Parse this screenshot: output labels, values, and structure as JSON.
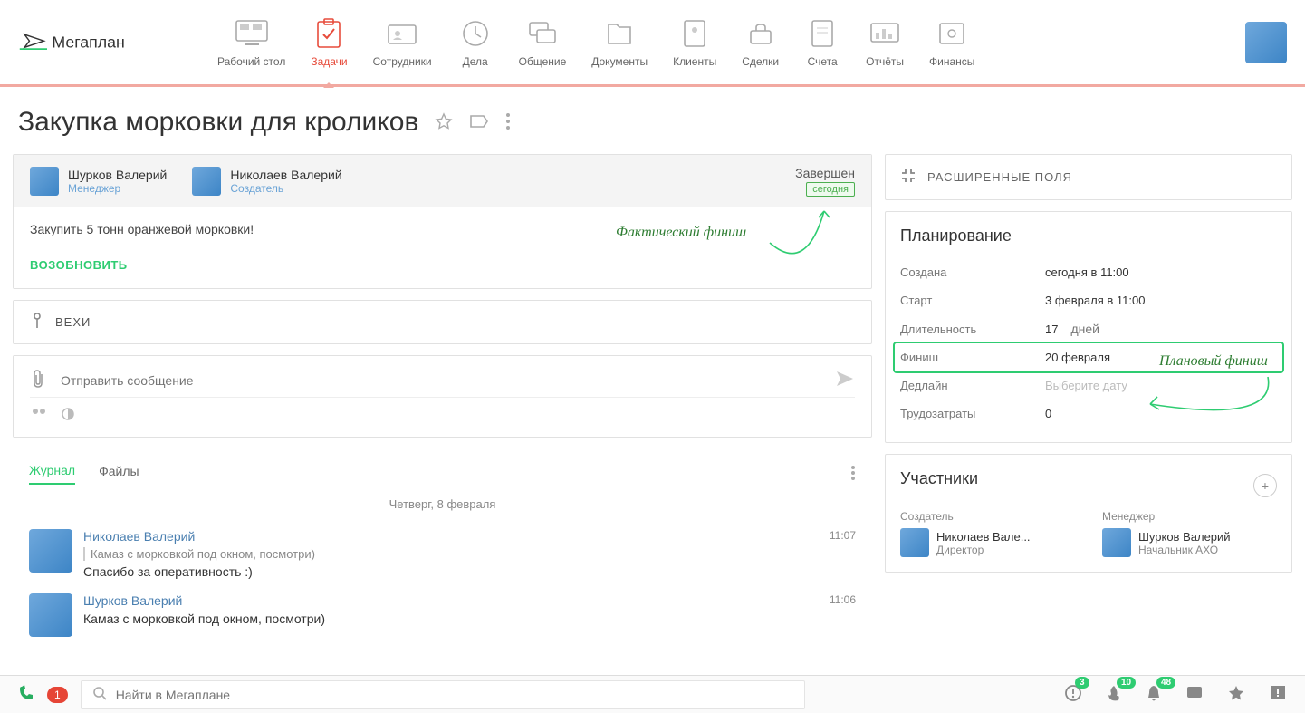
{
  "logo": "Мегаплан",
  "nav": [
    {
      "label": "Рабочий стол"
    },
    {
      "label": "Задачи"
    },
    {
      "label": "Сотрудники"
    },
    {
      "label": "Дела"
    },
    {
      "label": "Общение"
    },
    {
      "label": "Документы"
    },
    {
      "label": "Клиенты"
    },
    {
      "label": "Сделки"
    },
    {
      "label": "Счета"
    },
    {
      "label": "Отчёты"
    },
    {
      "label": "Финансы"
    }
  ],
  "page_title": "Закупка морковки для кроликов",
  "task_header": {
    "manager": {
      "name": "Шурков Валерий",
      "role": "Менеджер"
    },
    "creator": {
      "name": "Николаев Валерий",
      "role": "Создатель"
    },
    "status": "Завершен",
    "status_badge": "сегодня"
  },
  "task_body": {
    "description": "Закупить 5 тонн оранжевой морковки!",
    "resume": "ВОЗОБНОВИТЬ"
  },
  "milestones_label": "ВЕХИ",
  "message": {
    "placeholder": "Отправить сообщение"
  },
  "tabs": {
    "journal": "Журнал",
    "files": "Файлы"
  },
  "journal": {
    "date": "Четверг, 8 февраля",
    "entries": [
      {
        "author": "Николаев Валерий",
        "quote": "Камаз с морковкой под окном, посмотри)",
        "text": "Спасибо за оперативность :)",
        "time": "11:07"
      },
      {
        "author": "Шурков Валерий",
        "text": "Камаз с морковкой под окном, посмотри)",
        "time": "11:06"
      }
    ]
  },
  "sidebar": {
    "expand_fields": "РАСШИРЕННЫЕ ПОЛЯ",
    "planning": {
      "title": "Планирование",
      "rows": {
        "created": {
          "label": "Создана",
          "value": "сегодня в 11:00"
        },
        "start": {
          "label": "Старт",
          "value": "3 февраля в 11:00"
        },
        "duration": {
          "label": "Длительность",
          "value": "17",
          "unit": "дней"
        },
        "finish": {
          "label": "Финиш",
          "value": "20 февраля"
        },
        "deadline": {
          "label": "Дедлайн",
          "placeholder": "Выберите дату"
        },
        "labor": {
          "label": "Трудозатраты",
          "value": "0"
        }
      }
    },
    "participants": {
      "title": "Участники",
      "creator_label": "Создатель",
      "manager_label": "Менеджер",
      "creator": {
        "name": "Николаев Вале...",
        "title": "Директор"
      },
      "manager": {
        "name": "Шурков Валерий",
        "title": "Начальник АХО"
      }
    }
  },
  "annotations": {
    "actual_finish": "Фактический финиш",
    "planned_finish": "Плановый финиш"
  },
  "bottom": {
    "phone_badge": "1",
    "search_placeholder": "Найти в Мегаплане",
    "counts": {
      "a": "3",
      "b": "10",
      "c": "48"
    }
  }
}
